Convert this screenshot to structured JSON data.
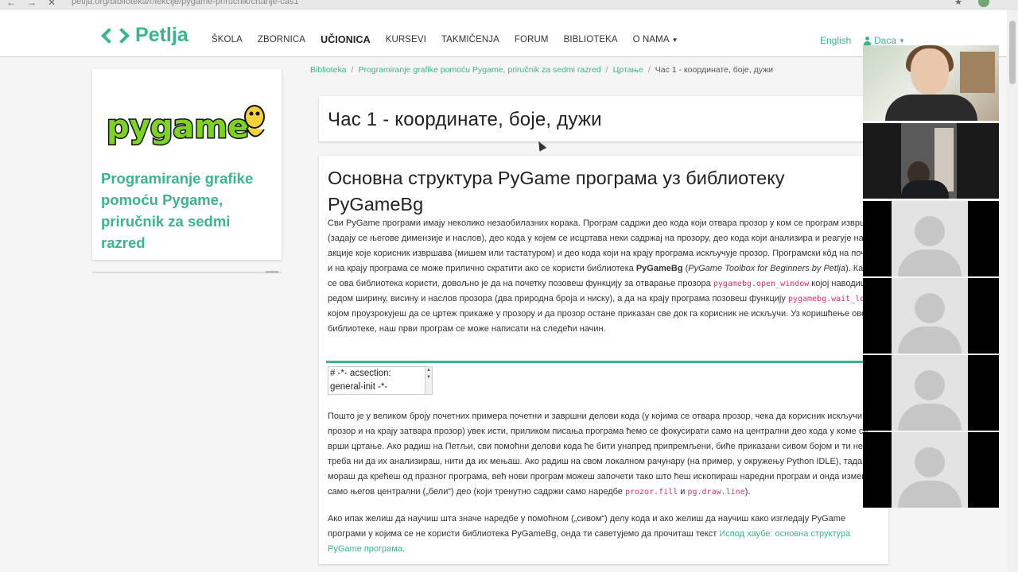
{
  "browser": {
    "url": "petlja.org/biblioteka/r/lekcije/pygame-prirucnik/crtanje-cas1"
  },
  "header": {
    "logo": "Petlja",
    "nav": [
      {
        "label": "ŠKOLA"
      },
      {
        "label": "ZBORNICA"
      },
      {
        "label": "UČIONICA"
      },
      {
        "label": "KURSEVI"
      },
      {
        "label": "TAKMIČENJA"
      },
      {
        "label": "FORUM"
      },
      {
        "label": "BIBLIOTEKA"
      },
      {
        "label": "O NAMA"
      }
    ],
    "language": "English",
    "user": "Daca"
  },
  "sidebar": {
    "logo_text": "pygame",
    "title": "Programiranje grafike pomoću Pygame, priručnik za sedmi razred"
  },
  "breadcrumb": {
    "items": [
      "Biblioteka",
      "Programiranje grafike pomoću Pygame, priručnik za sedmi razred",
      "Цртање"
    ],
    "current": "Час 1 - координате, боје, дужи"
  },
  "lesson": {
    "title": "Час 1 - координате, боје, дужи",
    "section_title": "Основна структура PyGame програма уз библиотеку PyGameBg",
    "p1": {
      "t1": "Сви PyGame програми имају неколико незаобилазних корака. Програм садржи део кода који отвара прозор у ком се програм извршава (задају се његове димензије и наслов), део кода у којем се исцртава неки садржај на прозору, део кода који анализира и реагује на акције које корисник извршава (мишем или тастатуром) и део кода који на крају програма искључује прозор. Програмски кôд на почетку и на крају програма се може прилично скратити ако се користи библиотека ",
      "lib": "PyGameBg",
      "t2": " (",
      "lib_full": "PyGame Toolbox for Beginners by Petlja",
      "t3": "). Када се ова библиотека користи, довољно је да на почетку позовеш функцију за отварање прозора ",
      "code1": "pygamebg.open_window",
      "t4": " којој наводиш редом ширину, висину и наслов прозора (два природна броја и ниску), а да на крају програма позовеш функцију ",
      "code2": "pygamebg.wait_loop()",
      "t5": " којом проузрокујеш да се цртеж прикаже у прозору и да прозор остане приказан све док га корисник не искључи. Уз коришћење ове библиотеке, наш први програм се може написати на следећи начин."
    },
    "editor": {
      "line1": "# -*- acsection:",
      "line2": "general-init -*-"
    },
    "p2": {
      "t1": "Пошто је у великом броју почетних примера почетни и завршни делови кода (у којима се отвара прозор, чека да корисник искључи прозор и на крају затвара прозор) увек исти, приликом писања програма ћемо се фокусирати само на централни део кода у коме се врши цртање. Ако радиш на Петљи, сви помоћни делови кода ће бити унапред припремљени, биће приказани сивом бојом и ти не треба ни да их анализираш, нити да их мењаш. Ако радиш на свом локалном рачунару (на пример, у окружењу Python IDLE), тада не мораш да крећеш од празног програма, већ нови програм можеш започети тако што ћеш ископираш наредни програм и онда измениш само његов централни („бели“) део (који тренутно садржи само наредбе ",
      "code1": "prozor.fill",
      "t2": " и ",
      "code2": "pg.draw.line",
      "t3": ")."
    },
    "p3": {
      "t1": "Ако ипак желиш да научиш шта значе наредбе у помоћном („сивом“) делу кода и ако желиш да научиш како изгледају PyGame програми у којима се не користи библиотека PyGameBg, онда ти саветујемо да прочиташ текст ",
      "link": "Испод хаубе: основна структура PyGame програма",
      "t2": "."
    }
  },
  "video_tiles": 6,
  "colors": {
    "accent": "#3bb58b",
    "code": "#d6336c"
  }
}
